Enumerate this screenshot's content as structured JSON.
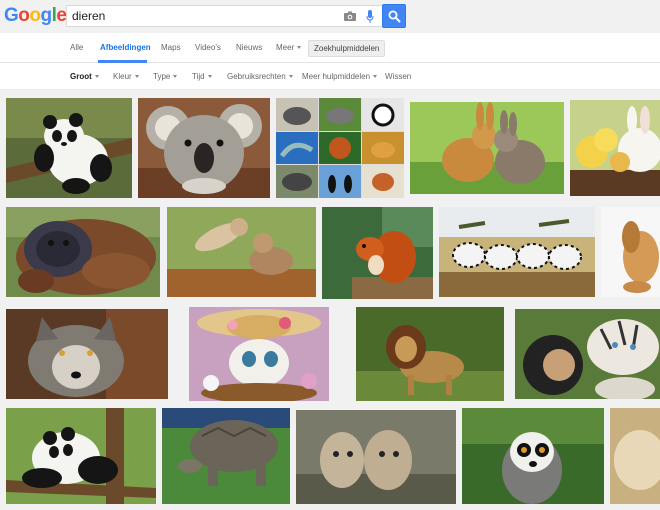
{
  "search": {
    "query": "dieren"
  },
  "logo": {
    "letters": [
      "G",
      "o",
      "o",
      "g",
      "l",
      "e"
    ],
    "colors": [
      "#4285f4",
      "#ea4335",
      "#fbbc05",
      "#4285f4",
      "#34a853",
      "#ea4335"
    ]
  },
  "tabs": [
    {
      "label": "Alle"
    },
    {
      "label": "Afbeeldingen"
    },
    {
      "label": "Maps"
    },
    {
      "label": "Video's"
    },
    {
      "label": "Nieuws"
    },
    {
      "label": "Meer"
    }
  ],
  "tools_label": "Zoekhulpmiddelen",
  "filters": [
    {
      "label": "Groot"
    },
    {
      "label": "Kleur"
    },
    {
      "label": "Type"
    },
    {
      "label": "Tijd"
    },
    {
      "label": "Gebruiksrechten"
    },
    {
      "label": "Meer hulpmiddelen"
    },
    {
      "label": "Wissen"
    }
  ],
  "colors": {
    "accent": "#4285f4",
    "active_tab": "#1a73e8"
  }
}
